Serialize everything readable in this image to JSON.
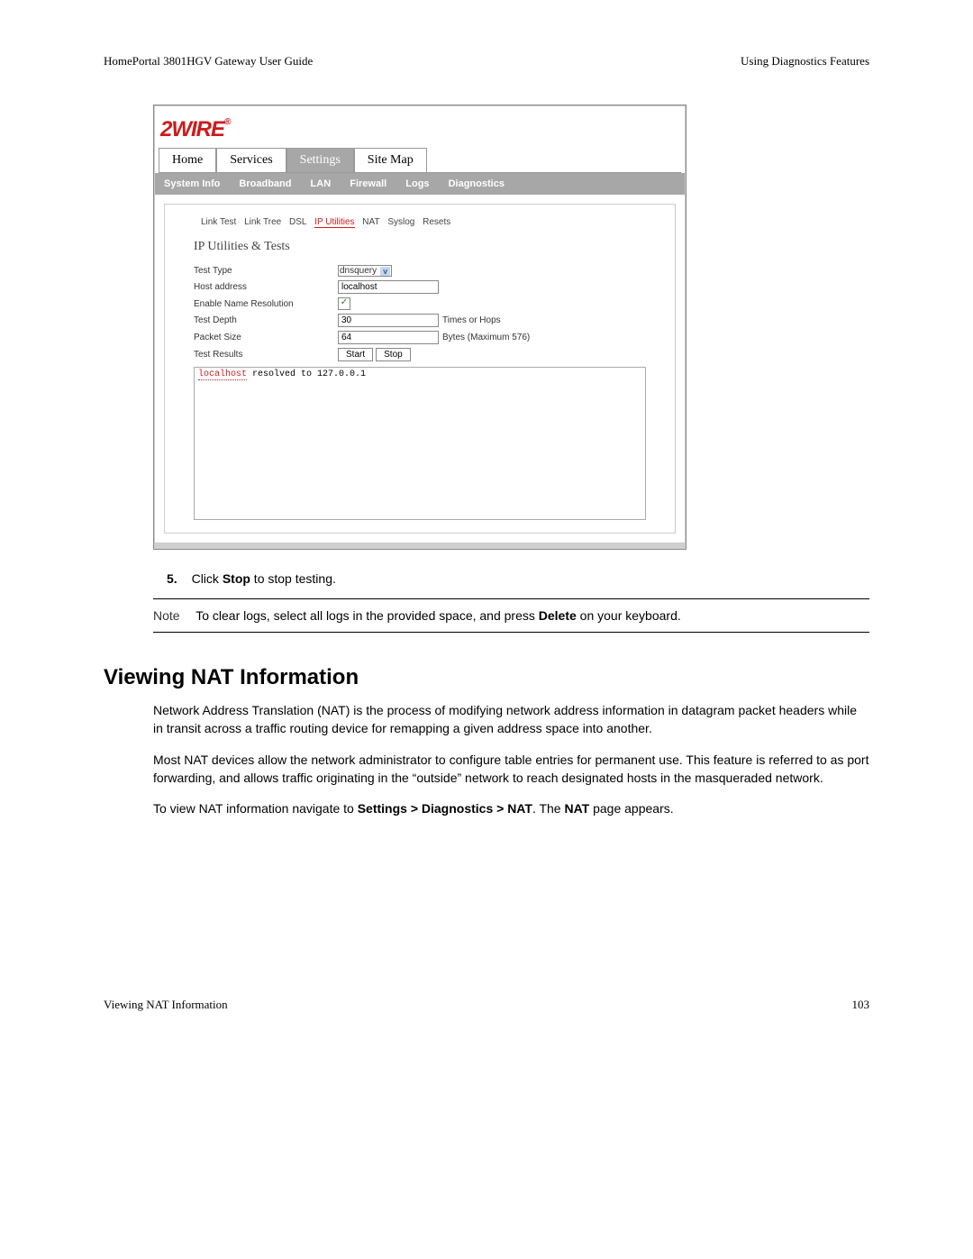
{
  "header": {
    "left": "HomePortal 3801HGV Gateway User Guide",
    "right": "Using Diagnostics Features"
  },
  "screenshot": {
    "logo": "2WIRE",
    "main_nav": {
      "items": [
        "Home",
        "Services",
        "Settings",
        "Site Map"
      ],
      "active_index": 2
    },
    "sub_nav": {
      "items": [
        "System Info",
        "Broadband",
        "LAN",
        "Firewall",
        "Logs",
        "Diagnostics"
      ],
      "active_index": 5
    },
    "tert_nav": {
      "items": [
        "Link Test",
        "Link Tree",
        "DSL",
        "IP Utilities",
        "NAT",
        "Syslog",
        "Resets"
      ],
      "active_index": 3
    },
    "section_title": "IP Utilities & Tests",
    "form": {
      "test_type": {
        "label": "Test Type",
        "value": "dnsquery"
      },
      "host_address": {
        "label": "Host address",
        "value": "localhost"
      },
      "enable_name_resolution": {
        "label": "Enable Name Resolution",
        "checked": true
      },
      "test_depth": {
        "label": "Test Depth",
        "value": "30",
        "after": "Times or Hops"
      },
      "packet_size": {
        "label": "Packet Size",
        "value": "64",
        "after": "Bytes (Maximum 576)"
      },
      "test_results": {
        "label": "Test Results",
        "start": "Start",
        "stop": "Stop"
      }
    },
    "results": {
      "host": "localhost",
      "rest": " resolved to 127.0.0.1"
    }
  },
  "step": {
    "number": "5.",
    "text_before": "Click ",
    "bold": "Stop",
    "text_after": " to stop testing."
  },
  "note": {
    "label": "Note",
    "text_before": "To clear logs, select all logs in the provided space, and press ",
    "bold": "Delete",
    "text_after": " on your keyboard."
  },
  "section_heading": "Viewing NAT Information",
  "paragraphs": {
    "p1": "Network Address Translation (NAT) is the process of modifying network address information in datagram packet headers while in transit across a traffic routing device for remapping a given address space into another.",
    "p2": "Most NAT devices allow the network administrator to configure table entries for permanent use. This feature is referred to as port forwarding, and allows traffic originating in the “outside” network to reach designated hosts in the masqueraded network.",
    "p3_before": "To view NAT information navigate to ",
    "p3_bold1": "Settings > Diagnostics > NAT",
    "p3_middle": ". The ",
    "p3_bold2": "NAT",
    "p3_after": " page appears."
  },
  "footer": {
    "left": "Viewing NAT Information",
    "right": "103"
  }
}
